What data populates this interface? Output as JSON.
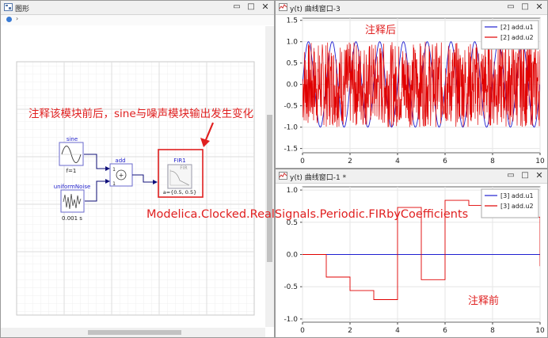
{
  "left_window": {
    "title": "图形",
    "diagram": {
      "blocks": {
        "sine": {
          "name": "sine",
          "param": "f=1"
        },
        "noise": {
          "name": "uniformNoise",
          "param": "0.001 s"
        },
        "add": {
          "name": "add",
          "in1": "1",
          "in2": "1",
          "op": "+"
        },
        "fir": {
          "name": "FIR1",
          "icon_text": "FIR",
          "param": "a={0.5, 0.5}"
        }
      }
    },
    "annotation": "注释该模块前后，sine与噪声模块输出发生变化",
    "class_path": "Modelica.Clocked.RealSignals.Periodic.FIRbyCoefficients"
  },
  "plot_top": {
    "title": "y(t) 曲线窗口-3",
    "annotation": "注释后",
    "chart_data": {
      "type": "line",
      "x_ticks": [
        "0",
        "2",
        "4",
        "6",
        "8",
        "10"
      ],
      "y_ticks": [
        "1.5",
        "1.0",
        "0.5",
        "0.0",
        "-0.5",
        "-1.0",
        "-1.5"
      ],
      "xlim": [
        0,
        10
      ],
      "ylim": [
        -1.6,
        1.55
      ],
      "series": [
        {
          "name": "[2] add.u1",
          "color": "#1f1fd0",
          "kind": "sine",
          "amplitude": 1.0,
          "frequency": 1
        },
        {
          "name": "[2] add.u2",
          "color": "#e00000",
          "kind": "noise",
          "min": -1,
          "max": 1,
          "sample_period": 0.001
        }
      ],
      "legend": "top-right"
    }
  },
  "plot_bottom": {
    "title": "y(t) 曲线窗口-1 *",
    "annotation": "注释前",
    "chart_data": {
      "type": "line",
      "x_ticks": [
        "0",
        "2",
        "4",
        "6",
        "8",
        "10"
      ],
      "y_ticks": [
        "1.0",
        "0.5",
        "0.0",
        "-0.5",
        "-1.0"
      ],
      "xlim": [
        0,
        10
      ],
      "ylim": [
        -1.05,
        1.05
      ],
      "series": [
        {
          "name": "[3] add.u1",
          "color": "#1f1fd0",
          "x": [
            0,
            10
          ],
          "y": [
            0.0,
            0.0
          ]
        },
        {
          "name": "[3] add.u2",
          "color": "#e00000",
          "step": true,
          "x": [
            1,
            2,
            3,
            4,
            5,
            6,
            7,
            8,
            9,
            10
          ],
          "y": [
            -0.35,
            -0.56,
            -0.7,
            0.73,
            -0.39,
            0.84,
            0.76,
            0.61,
            0.58,
            -0.18
          ]
        },
        {
          "name": "",
          "color": "#e00000",
          "x": [
            0,
            1
          ],
          "y": [
            0.0,
            0.0
          ]
        }
      ],
      "legend": "top-right"
    }
  }
}
